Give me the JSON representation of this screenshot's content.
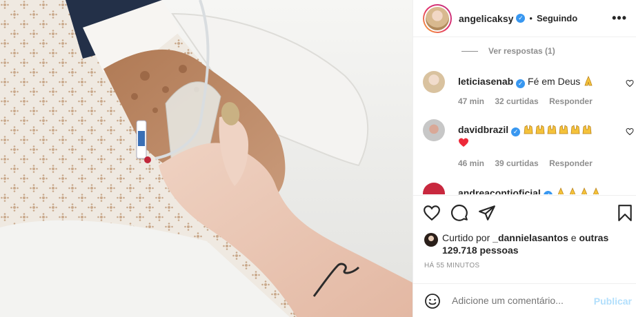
{
  "photo": {
    "description_icon": "post-photo"
  },
  "header": {
    "username": "angelicaksy",
    "verified": true,
    "separator": "•",
    "follow_status": "Seguindo",
    "more_icon": "more-options-icon"
  },
  "comments": {
    "view_replies": "Ver respostas (1)",
    "items": [
      {
        "username": "leticiasenab",
        "verified": true,
        "text": "Fé em Deus",
        "emoji": [
          "praying-hands"
        ],
        "time": "47 min",
        "likes": "32 curtidas",
        "reply": "Responder"
      },
      {
        "username": "davidbrazil",
        "verified": true,
        "text": "",
        "emoji": [
          "raised-hands",
          "raised-hands",
          "raised-hands",
          "raised-hands",
          "raised-hands",
          "raised-hands",
          "red-heart"
        ],
        "time": "46 min",
        "likes": "39 curtidas",
        "reply": "Responder"
      },
      {
        "username": "andreacontioficial",
        "verified": true,
        "emoji": [
          "praying-hands",
          "praying-hands",
          "praying-hands",
          "praying-hands"
        ]
      }
    ]
  },
  "actions": {
    "like_icon": "heart-icon",
    "comment_icon": "comment-icon",
    "share_icon": "share-icon",
    "save_icon": "bookmark-icon"
  },
  "likes": {
    "prefix": "Curtido por",
    "user": "_dannielasantos",
    "joiner": "e",
    "others": "outras 129.718 pessoas"
  },
  "time_ago": "HÁ 55 MINUTOS",
  "add_comment": {
    "placeholder": "Adicione um comentário...",
    "publish": "Publicar"
  },
  "colors": {
    "verified": "#3897f0",
    "secondary_text": "#8e8e8e",
    "publish_disabled": "#b2dffc",
    "heart_red": "#ed2939"
  }
}
